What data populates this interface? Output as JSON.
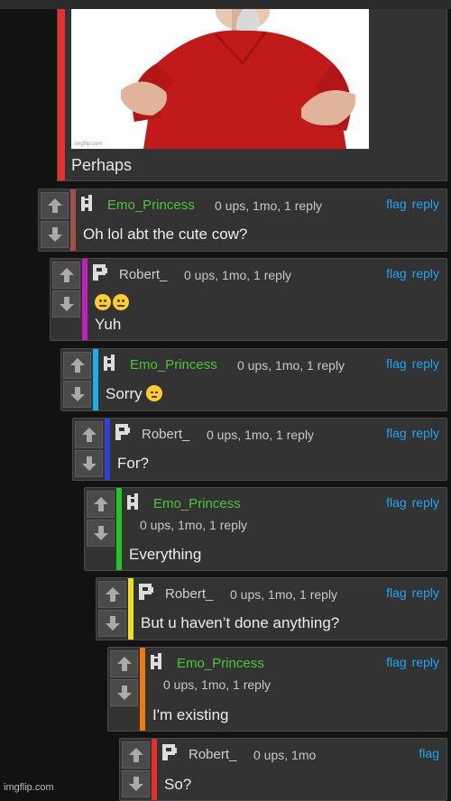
{
  "post": {
    "caption": "Perhaps",
    "image_watermark": "imgflip.com"
  },
  "comments": [
    {
      "username": "Emo_Princess",
      "meta": "0 ups, 1mo, 1 reply",
      "flag": "flag",
      "reply": "reply",
      "text": "Oh lol abt the cute cow?",
      "bar_color": "#a0504a"
    },
    {
      "username": "Robert_",
      "meta": "0 ups, 1mo, 1 reply",
      "flag": "flag",
      "reply": "reply",
      "text": "Yuh",
      "emoji_line": "😐😐",
      "bar_color": "#c020c0"
    },
    {
      "username": "Emo_Princess",
      "meta": "0 ups, 1mo, 1 reply",
      "flag": "flag",
      "reply": "reply",
      "text": "Sorry",
      "emoji": "😔",
      "bar_color": "#1ab0e8"
    },
    {
      "username": "Robert_",
      "meta": "0 ups, 1mo, 1 reply",
      "flag": "flag",
      "reply": "reply",
      "text": "For?",
      "bar_color": "#3040d8"
    },
    {
      "username": "Emo_Princess",
      "meta": "0 ups, 1mo, 1 reply",
      "flag": "flag",
      "reply": "reply",
      "text": "Everything",
      "bar_color": "#20c820"
    },
    {
      "username": "Robert_",
      "meta": "0 ups, 1mo, 1 reply",
      "flag": "flag",
      "reply": "reply",
      "text": "But u haven’t done anything?",
      "bar_color": "#e8e020"
    },
    {
      "username": "Emo_Princess",
      "meta": "0 ups, 1mo, 1 reply",
      "flag": "flag",
      "reply": "reply",
      "text": "I'm existing",
      "bar_color": "#f07810"
    },
    {
      "username": "Robert_",
      "meta": "0 ups, 1mo",
      "flag": "flag",
      "text": "So?",
      "bar_color": "#e53030"
    }
  ],
  "watermark": "imgflip.com",
  "icons": {
    "upvote": "arrow-up-icon",
    "downvote": "arrow-down-icon",
    "avatar": "pixel-avatar-icon"
  }
}
